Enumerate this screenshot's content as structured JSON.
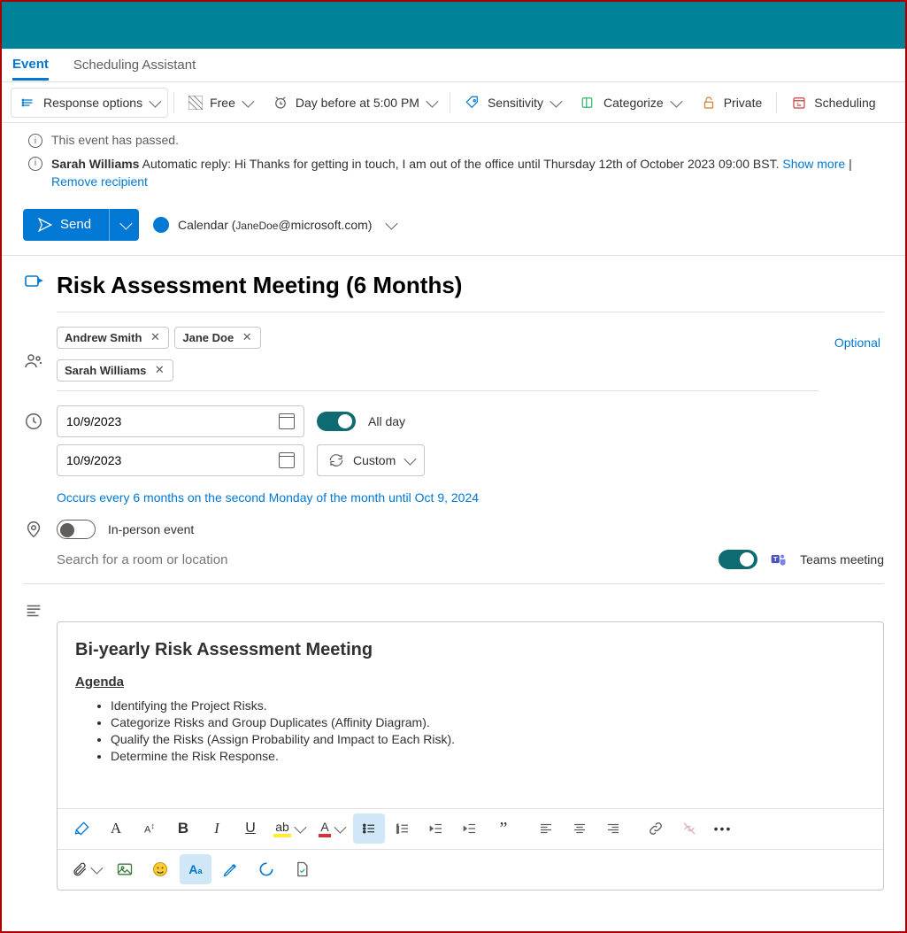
{
  "tabs": {
    "event": "Event",
    "scheduling": "Scheduling Assistant"
  },
  "toolbar": {
    "response": "Response options",
    "free": "Free",
    "reminder": "Day before at 5:00 PM",
    "sensitivity": "Sensitivity",
    "categorize": "Categorize",
    "private": "Private",
    "scheduling": "Scheduling"
  },
  "banners": {
    "past": "This event has passed.",
    "auto_name": "Sarah Williams",
    "auto_text": "Automatic reply: Hi Thanks for getting in touch, I am out of the office until Thursday 12th of October 2023 09:00 BST.",
    "show_more": "Show more",
    "remove": "Remove recipient"
  },
  "send": "Send",
  "calendar": {
    "prefix": "Calendar (",
    "user": "JaneDoe",
    "suffix": "@microsoft.com)"
  },
  "title": "Risk Assessment Meeting (6 Months)",
  "attendees": {
    "a1": "Andrew Smith",
    "a2": "Jane Doe",
    "a3": "Sarah Williams",
    "optional": "Optional"
  },
  "dates": {
    "start": "10/9/2023",
    "end": "10/9/2023",
    "allday_label": "All day",
    "custom": "Custom",
    "recurrence": "Occurs every 6 months on the second Monday of the month until Oct 9, 2024"
  },
  "inperson_label": "In-person event",
  "location_placeholder": "Search for a room or location",
  "teams_label": "Teams meeting",
  "body": {
    "heading": "Bi-yearly Risk Assessment Meeting",
    "agenda_label": "Agenda",
    "items": {
      "i1": "Identifying the Project Risks.",
      "i2": "Categorize Risks and Group Duplicates (Affinity Diagram).",
      "i3": "Qualify the Risks (Assign Probability and Impact to Each Risk).",
      "i4": "Determine the Risk Response."
    }
  }
}
